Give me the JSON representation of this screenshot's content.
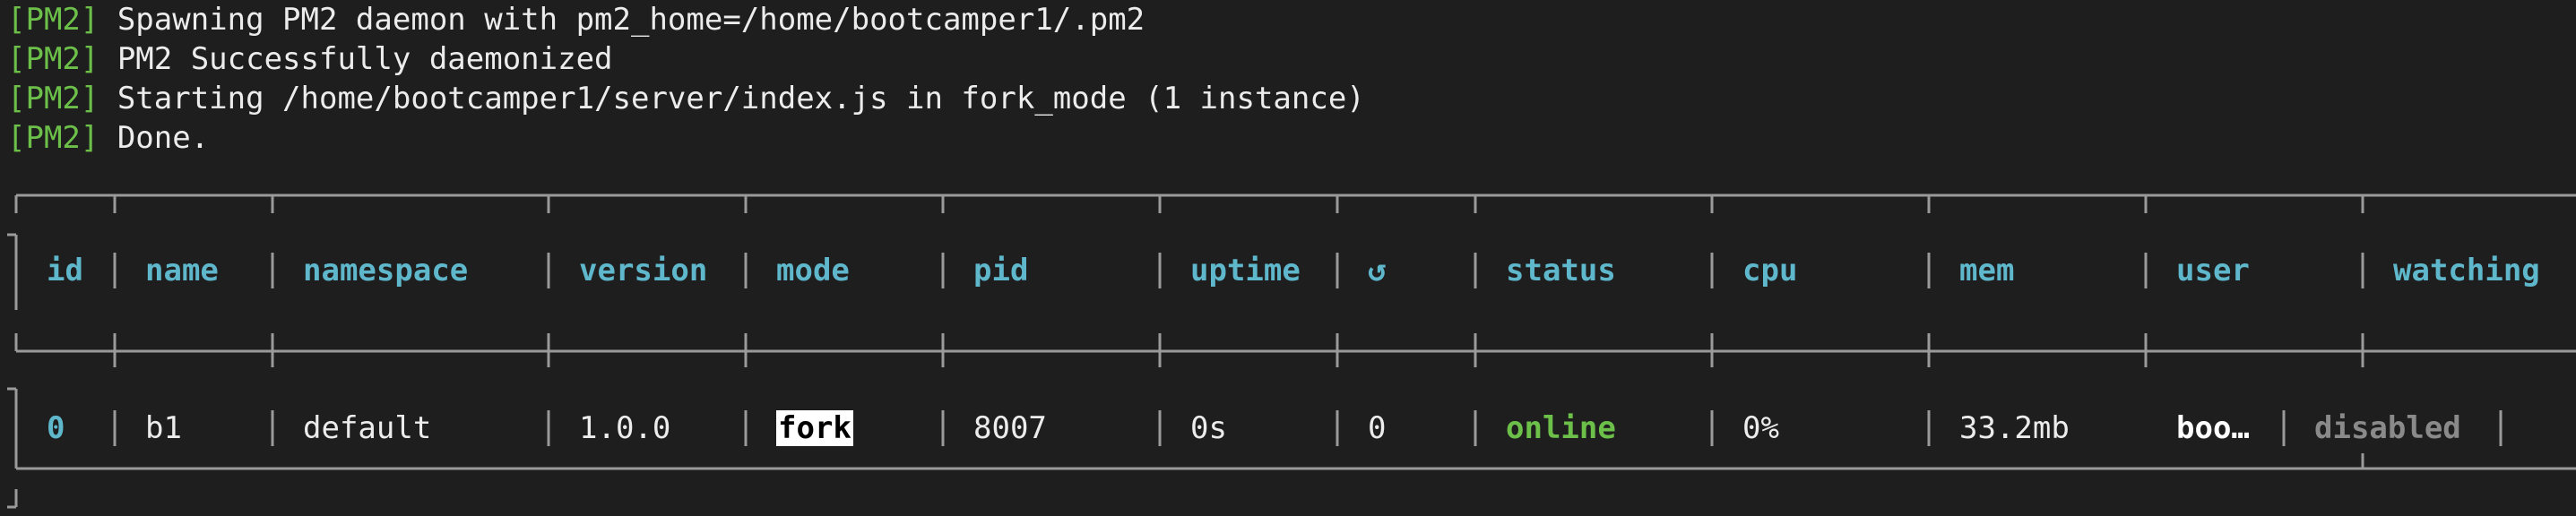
{
  "log_lines": [
    {
      "tag": "[PM2]",
      "text": " Spawning PM2 daemon with pm2_home=/home/bootcamper1/.pm2"
    },
    {
      "tag": "[PM2]",
      "text": " PM2 Successfully daemonized"
    },
    {
      "tag": "[PM2]",
      "text": " Starting /home/bootcamper1/server/index.js in fork_mode (1 instance)"
    },
    {
      "tag": "[PM2]",
      "text": " Done."
    }
  ],
  "table": {
    "headers": {
      "id": "id",
      "name": "name",
      "namespace": "namespace",
      "version": "version",
      "mode": "mode",
      "pid": "pid",
      "uptime": "uptime",
      "restarts": "↺",
      "status": "status",
      "cpu": "cpu",
      "mem": "mem",
      "user": "user",
      "watching": "watching"
    },
    "row": {
      "id": "0",
      "name": "b1",
      "namespace": "default",
      "version": "1.0.0",
      "mode": "fork",
      "pid": "8007",
      "uptime": "0s",
      "restarts": "0",
      "status": "online",
      "cpu": "0%",
      "mem": "33.2mb",
      "user": "boo…",
      "watching": "disabled"
    }
  },
  "colors": {
    "background": "#1e1e1e",
    "tag": "#6cc04a",
    "header": "#5fb7cc",
    "online": "#6cc04a",
    "border": "#9a9a9a"
  }
}
